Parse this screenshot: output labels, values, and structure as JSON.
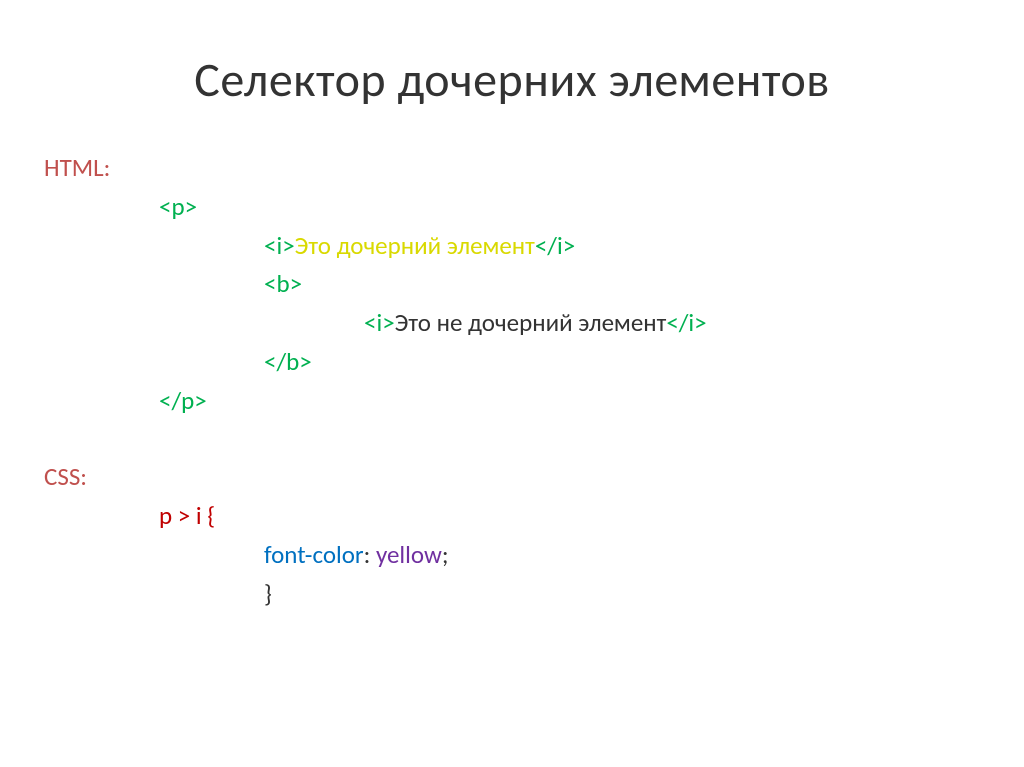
{
  "title": "Селектор дочерних элементов",
  "labels": {
    "html": "HTML:",
    "css": "CSS:"
  },
  "html_code": {
    "p_open": "<p>",
    "i_open1": "<i>",
    "text1": "Это дочерний элемент",
    "i_close1": "</i>",
    "b_open": "<b>",
    "i_open2": "<i>",
    "text2": "Это не дочерний элемент",
    "i_close2": "</i>",
    "b_close": "</b>",
    "p_close": "</p>"
  },
  "css_code": {
    "selector": "p > i {",
    "property": "font-color",
    "colon": ": ",
    "value": "yellow",
    "semicolon": ";",
    "close_brace": "}"
  }
}
